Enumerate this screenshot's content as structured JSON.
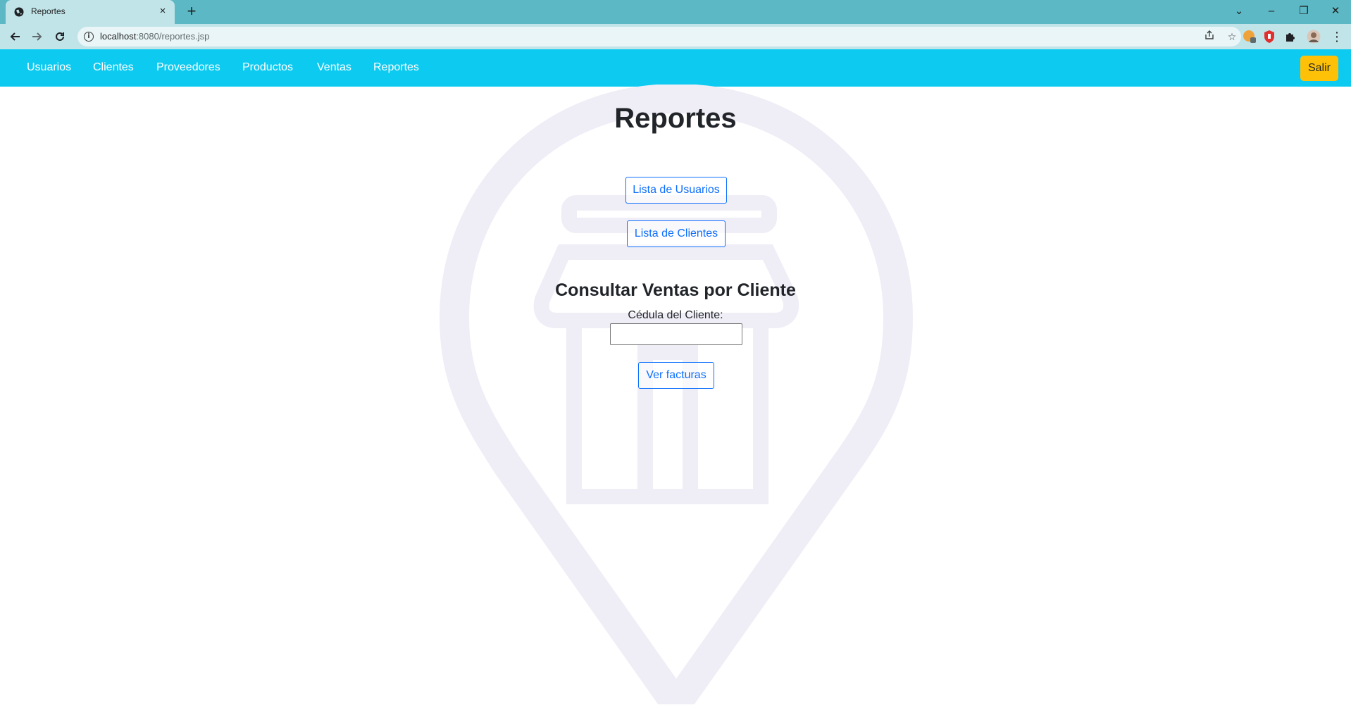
{
  "browser": {
    "tab_title": "Reportes",
    "tab_close": "×",
    "new_tab": "+",
    "url_host": "localhost",
    "url_path": ":8080/reportes.jsp",
    "window_controls": {
      "minimize": "–",
      "restore": "❐",
      "close": "✕",
      "tab_search": "⌄"
    }
  },
  "navbar": {
    "items": [
      "Usuarios",
      "Clientes",
      "Proveedores",
      "Productos",
      "Ventas",
      "Reportes"
    ],
    "logout_label": "Salir",
    "bg_color": "#0dcaf0",
    "logout_color": "#ffc107"
  },
  "main": {
    "title": "Reportes",
    "buttons": {
      "usuarios": "Lista de Usuarios",
      "clientes": "Lista de Clientes",
      "ver_facturas": "Ver facturas"
    },
    "consulta": {
      "title": "Consultar Ventas por Cliente",
      "label": "Cédula del Cliente:",
      "value": ""
    },
    "accent_color": "#0d6efd"
  }
}
